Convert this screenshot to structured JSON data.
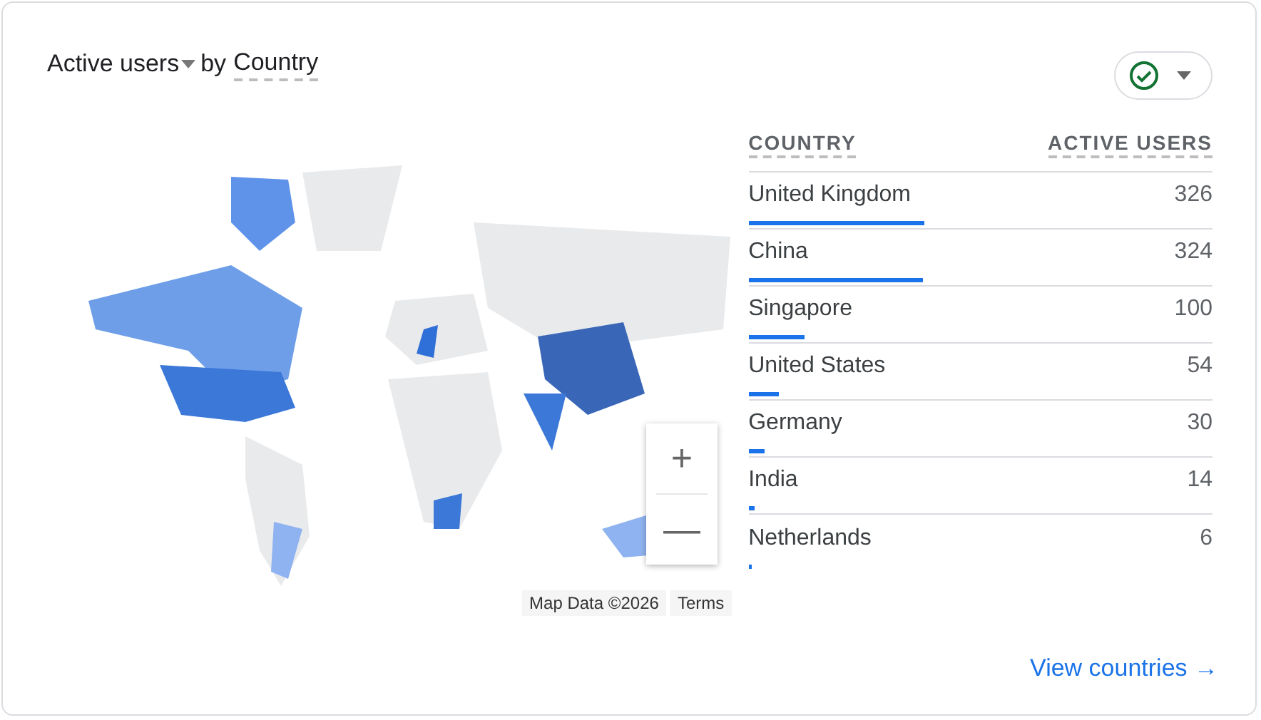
{
  "card": {
    "title_metric": "Active users",
    "title_joiner": "by",
    "title_dimension": "Country",
    "status": {
      "ok": true
    }
  },
  "map": {
    "kind": "picture",
    "zoom_in": "+",
    "zoom_out": "—",
    "attribution": "Map Data ©2026",
    "terms": "Terms"
  },
  "table": {
    "columns": [
      "COUNTRY",
      "ACTIVE USERS"
    ],
    "rows": [
      {
        "country": "United Kingdom",
        "users": "326",
        "level": 0.38
      },
      {
        "country": "China",
        "users": "324",
        "level": 0.375
      },
      {
        "country": "Singapore",
        "users": "100",
        "level": 0.12
      },
      {
        "country": "United States",
        "users": "54",
        "level": 0.065
      },
      {
        "country": "Germany",
        "users": "30",
        "level": 0.035
      },
      {
        "country": "India",
        "users": "14",
        "level": 0.015
      },
      {
        "country": "Netherlands",
        "users": "6"
      }
    ]
  },
  "footer": {
    "link": "View countries",
    "arrow": "→"
  }
}
